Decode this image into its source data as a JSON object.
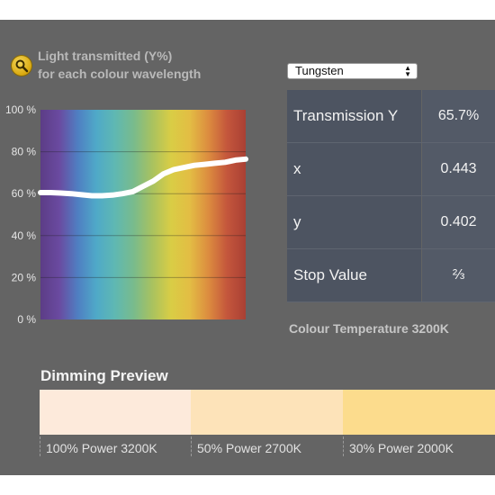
{
  "chart": {
    "title": "Light transmitted (Y%)\nfor each colour wavelength",
    "y_ticks": [
      "100 %",
      "80 %",
      "60 %",
      "40 %",
      "20 %",
      "0 %"
    ]
  },
  "chart_data": {
    "type": "line",
    "title": "Light transmitted (Y%)\nfor each colour wavelength",
    "xlabel": "",
    "ylabel": "",
    "ylim": [
      0,
      100
    ],
    "yticks": [
      "0 %",
      "20 %",
      "40 %",
      "60 %",
      "80 %",
      "100 %"
    ],
    "grid": true,
    "x": [
      0,
      5,
      10,
      15,
      20,
      25,
      30,
      35,
      40,
      45,
      50,
      55,
      60,
      65,
      70,
      75,
      80,
      85,
      90,
      95,
      100
    ],
    "series": [
      {
        "values": [
          60.5,
          60.5,
          60.3,
          60.0,
          59.5,
          59.0,
          59.0,
          59.3,
          60.0,
          61.0,
          63.5,
          66.0,
          69.5,
          71.5,
          72.5,
          73.5,
          74.0,
          74.5,
          75.0,
          76.0,
          76.5
        ]
      }
    ],
    "spectrum_colors": [
      "#5c3d86",
      "#6a4aa0",
      "#4f7fc2",
      "#4fa9c8",
      "#5fb8b2",
      "#79bb8c",
      "#a9c25f",
      "#d9cd45",
      "#e3bd44",
      "#dc8c3f",
      "#c4563c",
      "#a94034"
    ]
  },
  "source_select": {
    "value": "Tungsten"
  },
  "readout": {
    "rows": [
      {
        "label": "Transmission Y",
        "value": "65.7%"
      },
      {
        "label": "x",
        "value": "0.443"
      },
      {
        "label": "y",
        "value": "0.402"
      },
      {
        "label": "Stop Value",
        "value": "⅔"
      }
    ],
    "colour_temperature": "Colour Temperature 3200K"
  },
  "dimming": {
    "title": "Dimming Preview",
    "swatches": [
      {
        "label": "100% Power 3200K",
        "color": "#fdeadb"
      },
      {
        "label": "50% Power 2700K",
        "color": "#fde3b9"
      },
      {
        "label": "30% Power 2000K",
        "color": "#fcdc8d"
      }
    ]
  },
  "icons": {
    "zoom": "magnifier-icon",
    "select_arrows": "updown-arrows-icon"
  },
  "colors": {
    "panel": "#646464",
    "table_label_bg": "#4d5461",
    "table_value_bg": "#535a67",
    "curve": "#ffffff"
  }
}
